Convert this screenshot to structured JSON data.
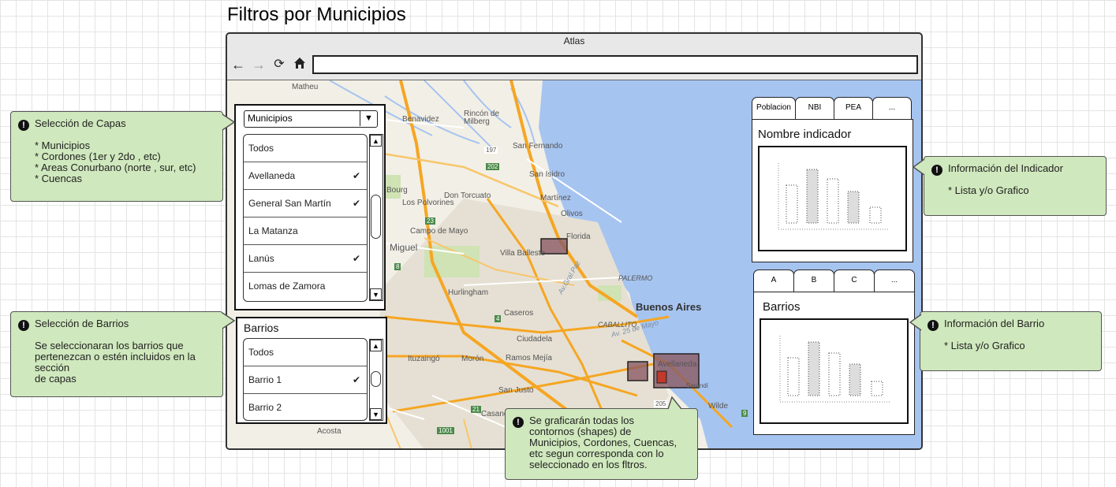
{
  "page": {
    "title": "Filtros por Municipios"
  },
  "browser": {
    "window_title": "Atlas",
    "url": ""
  },
  "map": {
    "labels": {
      "matheu": "Matheu",
      "benavidez": "Benavidez",
      "rincon": "Rincón de Milberg",
      "san_fernando": "San Fernando",
      "san_isidro": "San Isidro",
      "don_torcuato": "Don Torcuato",
      "los_polvorines": "Los Polvorines",
      "martinez": "Martínez",
      "olivos": "Olivos",
      "bourg": "Bourg",
      "campo_de_mayo": "Campo de Mayo",
      "florida": "Florida",
      "villa_ballester": "Villa Balleste",
      "san_miguel": "Miguel",
      "palermo": "PALERMO",
      "buenos_aires": "Buenos Aires",
      "hurlingham": "Hurlingham",
      "caseros": "Caseros",
      "caballito": "CABALLITO",
      "ciudadela": "Ciudadela",
      "ituzaingo": "Ituzaingó",
      "moron": "Morón",
      "ramos_mejia": "Ramos Mejía",
      "avellaneda": "Avellaneda",
      "sarandi": "Sarandí",
      "san_justo": "San Justo",
      "wilde": "Wilde",
      "casanova": "Casano",
      "acosta": "Acosta",
      "rio_de_la_plata_a": "Av.Gral.Paz",
      "av_25_mayo": "Av. 25 de Mayo",
      "route_197": "197",
      "route_202": "202",
      "route_23": "23",
      "route_205": "205",
      "route_1001": "1001",
      "route_4": "4",
      "route_21": "21",
      "route_8": "8",
      "route_9": "9"
    }
  },
  "capas_panel": {
    "dropdown_value": "Municipios",
    "items": [
      {
        "label": "Todos",
        "checked": false
      },
      {
        "label": "Avellaneda",
        "checked": true
      },
      {
        "label": "General San Martín",
        "checked": true
      },
      {
        "label": "La Matanza",
        "checked": false
      },
      {
        "label": "Lanús",
        "checked": true
      },
      {
        "label": "Lomas de Zamora",
        "checked": false
      }
    ]
  },
  "barrios_panel": {
    "title": "Barrios",
    "items": [
      {
        "label": "Todos",
        "checked": false
      },
      {
        "label": "Barrio 1",
        "checked": true
      },
      {
        "label": "Barrio 2",
        "checked": false
      }
    ]
  },
  "indicator_panel": {
    "tabs": [
      "Poblacion",
      "NBI",
      "PEA",
      "..."
    ],
    "heading": "Nombre indicador"
  },
  "barrio_info_panel": {
    "tabs": [
      "A",
      "B",
      "C",
      "..."
    ],
    "heading": "Barrios"
  },
  "callouts": {
    "capas": {
      "title": "Selección de Capas",
      "lines": [
        "* Municipios",
        "* Cordones (1er y 2do , etc)",
        "* Areas Conurbano (norte , sur, etc)",
        "* Cuencas"
      ]
    },
    "barrios": {
      "title": "Selección de Barrios",
      "lines": [
        "Se seleccionaran los barrios que",
        "pertenezcan o estén incluidos en la",
        "sección",
        "de capas"
      ]
    },
    "indicador": {
      "title": "Información del Indicador",
      "lines": [
        "* Lista y/o Grafico"
      ]
    },
    "barrio_info": {
      "title": "Información del Barrio",
      "lines": [
        "* Lista y/o Grafico"
      ]
    },
    "shapes": {
      "lines": [
        "Se graficarán todas los",
        "contornos (shapes) de",
        "Municipios, Cordones, Cuencas,",
        "etc segun corresponda con lo",
        "seleccionado en los fltros."
      ]
    }
  },
  "icons": {
    "back": "arrow-left-icon",
    "forward": "arrow-right-icon",
    "reload": "reload-icon",
    "home": "home-icon",
    "warning": "exclamation-icon",
    "check": "checkmark-icon",
    "dropdown": "triangle-down-icon"
  },
  "colors": {
    "callout_bg": "#cfe8bd",
    "water": "#a6c4f0",
    "highway": "#f5a623",
    "selection_shape": "#8b5a63",
    "selection_shape_red": "#c0392b"
  }
}
